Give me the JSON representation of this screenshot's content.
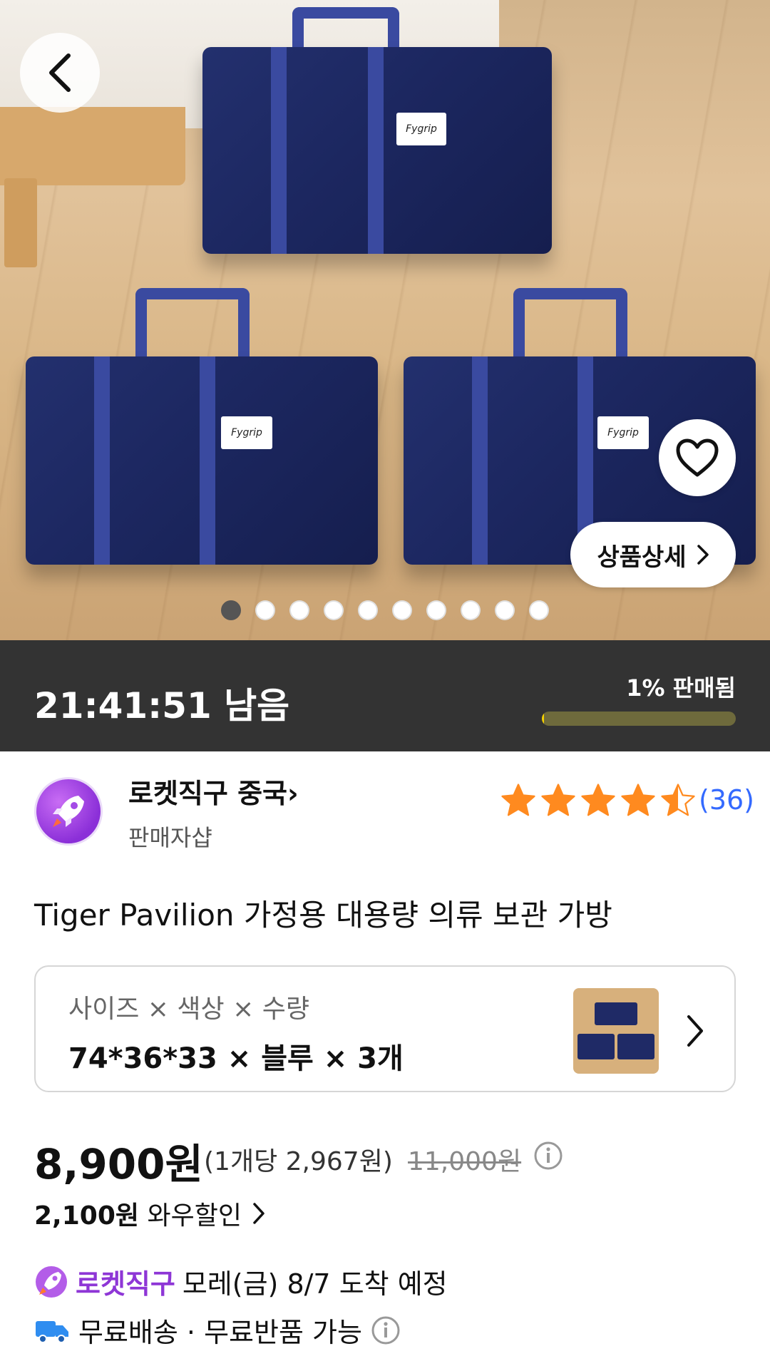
{
  "hero": {
    "bag_label": "Fygrip",
    "detail_button_label": "상품상세",
    "slide_count": 10,
    "active_slide": 1
  },
  "timer": {
    "remaining": "21:41:51 남음",
    "sold_text": "1% 판매됨",
    "sold_fraction": 0.01
  },
  "seller": {
    "name": "로켓직구 중국",
    "subtitle": "판매자샵",
    "rating": 4.5,
    "review_count": "(36)"
  },
  "product": {
    "title": "Tiger Pavilion 가정용 대용량 의류 보관 가방"
  },
  "option": {
    "label": "사이즈 × 색상 × 수량",
    "value": "74*36*33 × 블루 × 3개"
  },
  "price": {
    "sale": "8,900원",
    "unit": "(1개당 2,967원)",
    "original": "11,000원",
    "discount_amount": "2,100원",
    "discount_label": "와우할인"
  },
  "delivery": {
    "badge": "로켓직구",
    "arrival": "모레(금) 8/7 도착 예정",
    "shipping": "무료배송 · 무료반품 가능"
  },
  "colors": {
    "timer_bg": "#333333",
    "progress_fill": "#f5d000",
    "star": "#ff8a1f",
    "review_link": "#346aff",
    "rocket_purple": "#8e36d6"
  }
}
